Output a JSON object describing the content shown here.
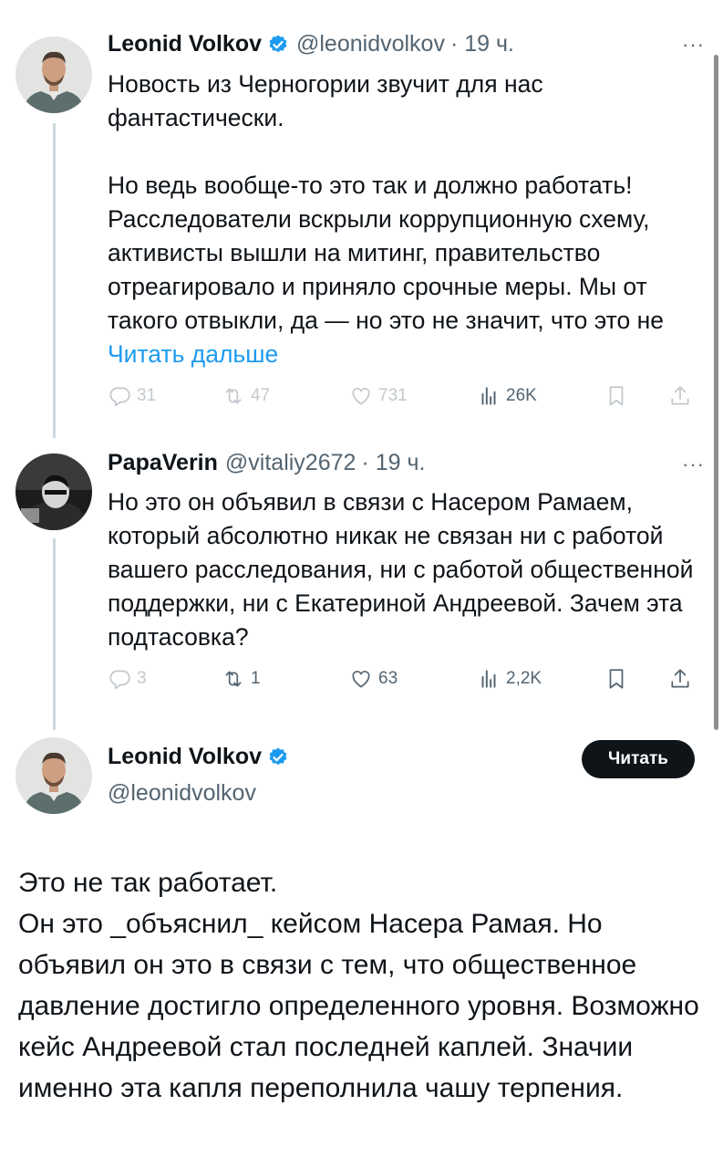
{
  "tweets": [
    {
      "author": "Leonid Volkov",
      "handle": "@leonidvolkov",
      "time": "· 19 ч.",
      "paragraphs": [
        "Новость из Черногории звучит для нас фантастически.",
        "Но ведь вообще-то это так и должно работать! Расследователи вскрыли коррупционную схему, активисты вышли на митинг, правительство отреагировало и приняло срочные меры. Мы от такого отвыкли, да — но это не значит, что это не"
      ],
      "read_more": "Читать дальше",
      "stats": {
        "replies": "31",
        "reposts": "47",
        "likes": "731",
        "views": "26K"
      }
    },
    {
      "author": "PapaVerin",
      "handle": "@vitaliy2672",
      "time": "· 19 ч.",
      "text": "Но это он объявил в связи с Насером Рамаем, который абсолютно никак не связан ни с работой вашего расследования, ни с работой общественной поддержки, ни с Екатериной Андреевой. Зачем эта подтасовка?",
      "stats": {
        "replies": "3",
        "reposts": "1",
        "likes": "63",
        "views": "2,2K"
      }
    }
  ],
  "main": {
    "author": "Leonid Volkov",
    "handle": "@leonidvolkov",
    "follow_label": "Читать",
    "lines": [
      "Это не так работает.",
      "Он это _объяснил_ кейсом Насера Рамая. Но объявил он это в связи с тем, что общественное давление достигло определенного уровня. Возможно кейс Андреевой стал последней каплей. Значии именно эта капля переполнила чашу терпения."
    ]
  },
  "colors": {
    "text": "#0f1419",
    "secondary": "#536471",
    "link": "#1d9bf0",
    "verified": "#1d9bf0"
  },
  "icons": [
    "more-icon",
    "verified-icon",
    "reply-icon",
    "repost-icon",
    "like-icon",
    "views-icon",
    "bookmark-icon",
    "share-icon"
  ]
}
